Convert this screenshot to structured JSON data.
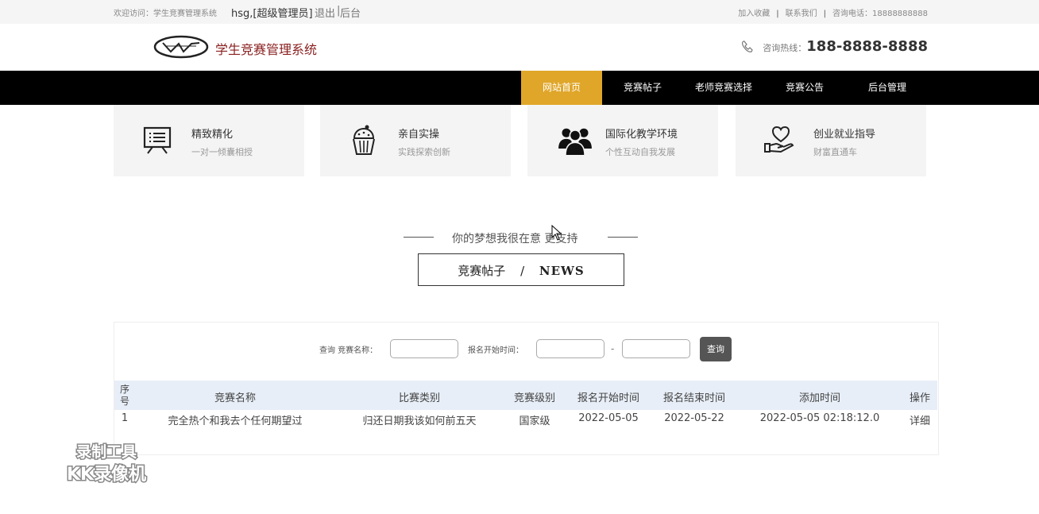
{
  "topbar": {
    "welcome": "欢迎访问：学生竞赛管理系统",
    "user": "hsg,[超级管理员]",
    "logout": "退出",
    "separator": "|",
    "admin": "后台",
    "favorite": "加入收藏",
    "contact": "联系我们",
    "phone": "咨询电话：18888888888"
  },
  "header": {
    "site_name": "学生竞赛管理系统",
    "hotline_label": "咨询热线：",
    "hotline_number": "188-8888-8888"
  },
  "nav": {
    "items": [
      "网站首页",
      "竞赛帖子",
      "老师竞赛选择",
      "竞赛公告",
      "后台管理"
    ],
    "active_index": 0
  },
  "features": [
    {
      "icon": "presentation-icon",
      "title": "精致精化",
      "subtitle": "一对一倾囊相授"
    },
    {
      "icon": "cupcake-icon",
      "title": "亲自实操",
      "subtitle": "实践探索创新"
    },
    {
      "icon": "group-icon",
      "title": "国际化教学环境",
      "subtitle": "个性互动自我发展"
    },
    {
      "icon": "heart-hand-icon",
      "title": "创业就业指导",
      "subtitle": "财富直通车"
    }
  ],
  "section": {
    "slogan": "你的梦想我很在意 更支持",
    "title": "竞赛帖子",
    "divider": "/",
    "english": "NEWS"
  },
  "search": {
    "query_label": "查询 竞赛名称：",
    "date_label": "报名开始时间：",
    "dash": "-",
    "button": "查询",
    "name_value": "",
    "start_value": "",
    "end_value": ""
  },
  "table": {
    "columns": [
      "序号",
      "竞赛名称",
      "比赛类别",
      "竞赛级别",
      "报名开始时间",
      "报名结束时间",
      "添加时间",
      "操作"
    ],
    "rows": [
      [
        "1",
        "完全热个和我去个任何期望过",
        "归还日期我该如何前五天",
        "国家级",
        "2022-05-05",
        "2022-05-22",
        "2022-05-05 02:18:12.0",
        "详细"
      ]
    ]
  },
  "watermark": {
    "line1": "录制工具",
    "line2": "KK录像机"
  },
  "colors": {
    "nav_bg": "#000000",
    "nav_active": "#e0a629",
    "brand": "#8a1f1f",
    "table_header": "#e7eef7"
  }
}
